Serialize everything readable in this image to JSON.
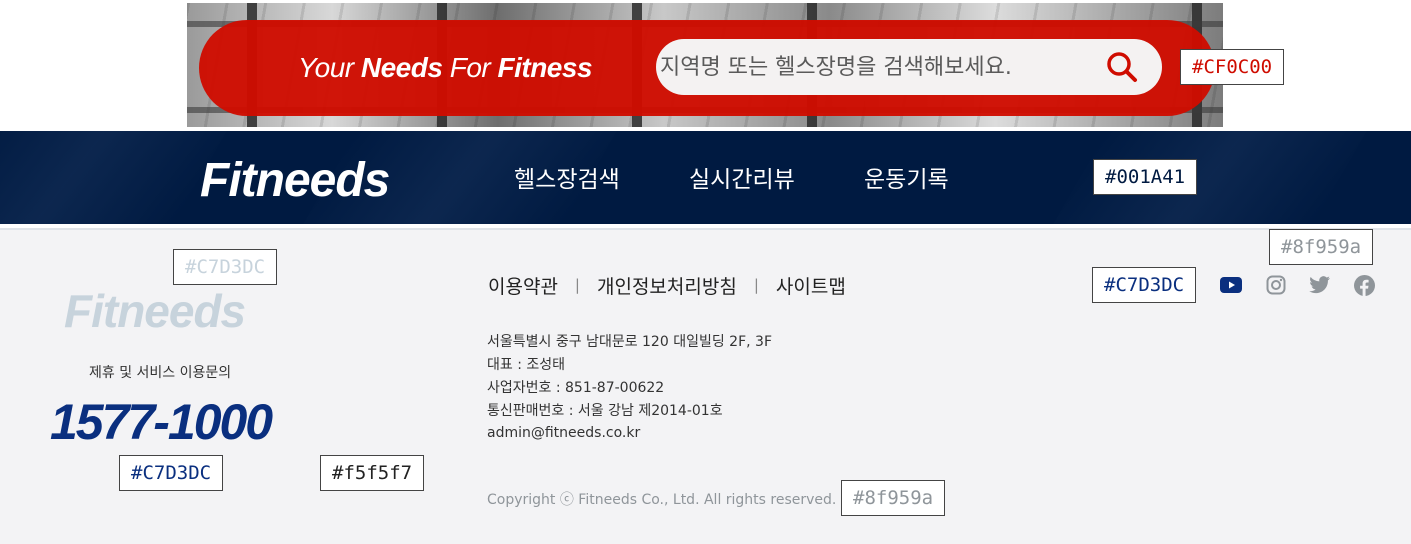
{
  "banner": {
    "slogan_part1": "Your ",
    "slogan_part2": "Needs",
    "slogan_part3": " For ",
    "slogan_part4": "Fitness",
    "search_placeholder": "지역명 또는 헬스장명을 검색해보세요.",
    "search_icon": "search-icon",
    "accent_color": "#CF0C00"
  },
  "nav": {
    "logo": "Fitneeds",
    "items": [
      {
        "label": "헬스장검색"
      },
      {
        "label": "실시간리뷰"
      },
      {
        "label": "운동기록"
      }
    ],
    "background_color": "#001A41"
  },
  "footer": {
    "logo": "Fitneeds",
    "inquiry_label": "제휴 및 서비스 이용문의",
    "phone": "1577-1000",
    "links": [
      {
        "label": "이용약관"
      },
      {
        "label": "개인정보처리방침"
      },
      {
        "label": "사이트맵"
      }
    ],
    "link_separator": "|",
    "info": [
      "서울특별시 중구 남대문로 120 대일빌딩 2F, 3F",
      "대표 : 조성태",
      "사업자번호 : 851-87-00622",
      "통신판매번호 : 서울 강남 제2014-01호",
      "admin@fitneeds.co.kr"
    ],
    "copyright": "Copyright ⓒ Fitneeds Co., Ltd. All rights reserved.",
    "social_icons": [
      "youtube-icon",
      "instagram-icon",
      "twitter-icon",
      "facebook-icon"
    ],
    "background_color": "#f5f5f7",
    "logo_color": "#C7D3DC",
    "text_muted_color": "#8f959a"
  },
  "swatches": {
    "banner_red": "#CF0C00",
    "nav_navy": "#001A41",
    "icon_grey": "#8f959a",
    "social_label": "#C7D3DC",
    "logo_label": "#C7D3DC",
    "phone_label": "#C7D3DC",
    "footer_bg_label": "#f5f5f7",
    "copyright_label": "#8f959a"
  }
}
